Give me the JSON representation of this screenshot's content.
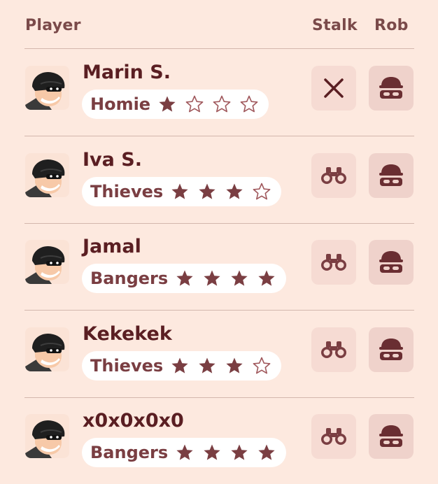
{
  "header": {
    "player_label": "Player",
    "stalk_label": "Stalk",
    "rob_label": "Rob"
  },
  "colors": {
    "background": "#fde9df",
    "text_dark": "#5a1e22",
    "accent": "#7a3e42",
    "button_bg": "#f6dbd3"
  },
  "players": [
    {
      "name": "Marin S.",
      "group": "Homie",
      "stars_filled": 1,
      "stars_total": 4,
      "stalk_icon": "close-icon",
      "rob_icon": "robber-mask-icon"
    },
    {
      "name": "Iva S.",
      "group": "Thieves",
      "stars_filled": 3,
      "stars_total": 4,
      "stalk_icon": "binoculars-icon",
      "rob_icon": "robber-mask-icon"
    },
    {
      "name": "Jamal",
      "group": "Bangers",
      "stars_filled": 4,
      "stars_total": 4,
      "stalk_icon": "binoculars-icon",
      "rob_icon": "robber-mask-icon"
    },
    {
      "name": "Kekekek",
      "group": "Thieves",
      "stars_filled": 3,
      "stars_total": 4,
      "stalk_icon": "binoculars-icon",
      "rob_icon": "robber-mask-icon"
    },
    {
      "name": "x0x0x0x0",
      "group": "Bangers",
      "stars_filled": 4,
      "stars_total": 4,
      "stalk_icon": "binoculars-icon",
      "rob_icon": "robber-mask-icon"
    }
  ]
}
